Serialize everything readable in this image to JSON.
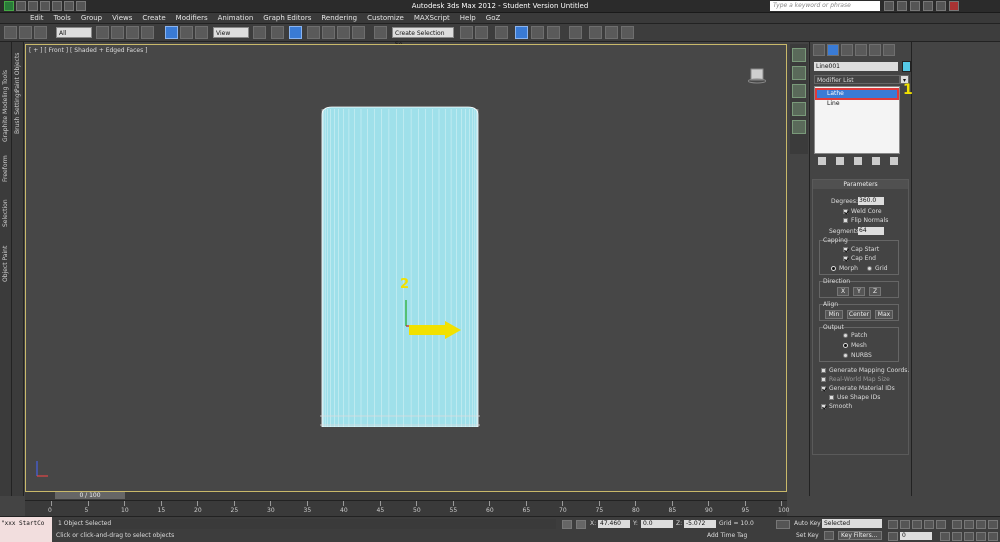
{
  "window": {
    "title": "Autodesk 3ds Max 2012 - Student Version  Untitled",
    "search_placeholder": "Type a keyword or phrase"
  },
  "menu": [
    "Edit",
    "Tools",
    "Group",
    "Views",
    "Create",
    "Modifiers",
    "Animation",
    "Graph Editors",
    "Rendering",
    "Customize",
    "MAXScript",
    "Help",
    "GoZ"
  ],
  "toolbar": {
    "selection_filter": "All",
    "reference_coord": "View",
    "named_selection": "Create Selection Se"
  },
  "left_tabs": {
    "rail1": [
      "Graphite Modeling Tools",
      "Freeform",
      "Selection",
      "Object Paint"
    ],
    "rail2": [
      "Paint Objects",
      "Brush Settings"
    ]
  },
  "viewport": {
    "label": "[ + ] [ Front ] [ Shaded + Edged Faces ]",
    "callout_label": "2",
    "gizmo_color": "#f2e100",
    "object_color": "#9fe0ea"
  },
  "command_panel": {
    "object_name": "Line001",
    "object_color": "#55c9e6",
    "modifier_list_label": "Modifier List",
    "stack": [
      {
        "label": "Lathe",
        "selected": true
      },
      {
        "label": "Line",
        "selected": false
      }
    ],
    "callout_label": "1",
    "parameters": {
      "title": "Parameters",
      "degrees_label": "Degrees:",
      "degrees_value": "360.0",
      "weld_core": "Weld Core",
      "flip_normals": "Flip Normals",
      "segments_label": "Segments:",
      "segments_value": "64",
      "capping_title": "Capping",
      "cap_start": "Cap Start",
      "cap_end": "Cap End",
      "morph": "Morph",
      "grid": "Grid",
      "direction_title": "Direction",
      "dir_x": "X",
      "dir_y": "Y",
      "dir_z": "Z",
      "align_title": "Align",
      "align_min": "Min",
      "align_center": "Center",
      "align_max": "Max",
      "output_title": "Output",
      "patch": "Patch",
      "mesh": "Mesh",
      "nurbs": "NURBS",
      "gen_mapping": "Generate Mapping Coords.",
      "real_world": "Real-World Map Size",
      "gen_material": "Generate Material IDs",
      "use_shape": "Use Shape IDs",
      "smooth": "Smooth"
    }
  },
  "timeline": {
    "slider": "0 / 100",
    "ticks": [
      "0",
      "5",
      "10",
      "15",
      "20",
      "25",
      "30",
      "35",
      "40",
      "45",
      "50",
      "55",
      "60",
      "65",
      "70",
      "75",
      "80",
      "85",
      "90",
      "95",
      "100"
    ]
  },
  "status": {
    "maxscript": "\"xxx StartCo",
    "selection": "1 Object Selected",
    "prompt": "Click or click-and-drag to select objects",
    "x_label": "X:",
    "x_value": "47.460",
    "y_label": "Y:",
    "y_value": "0.0",
    "z_label": "Z:",
    "z_value": "-5.072",
    "grid": "Grid = 10.0",
    "add_time_tag": "Add Time Tag",
    "auto_key": "Auto Key",
    "set_key": "Set Key",
    "selected": "Selected",
    "key_filters": "Key Filters...",
    "frame": "0"
  }
}
